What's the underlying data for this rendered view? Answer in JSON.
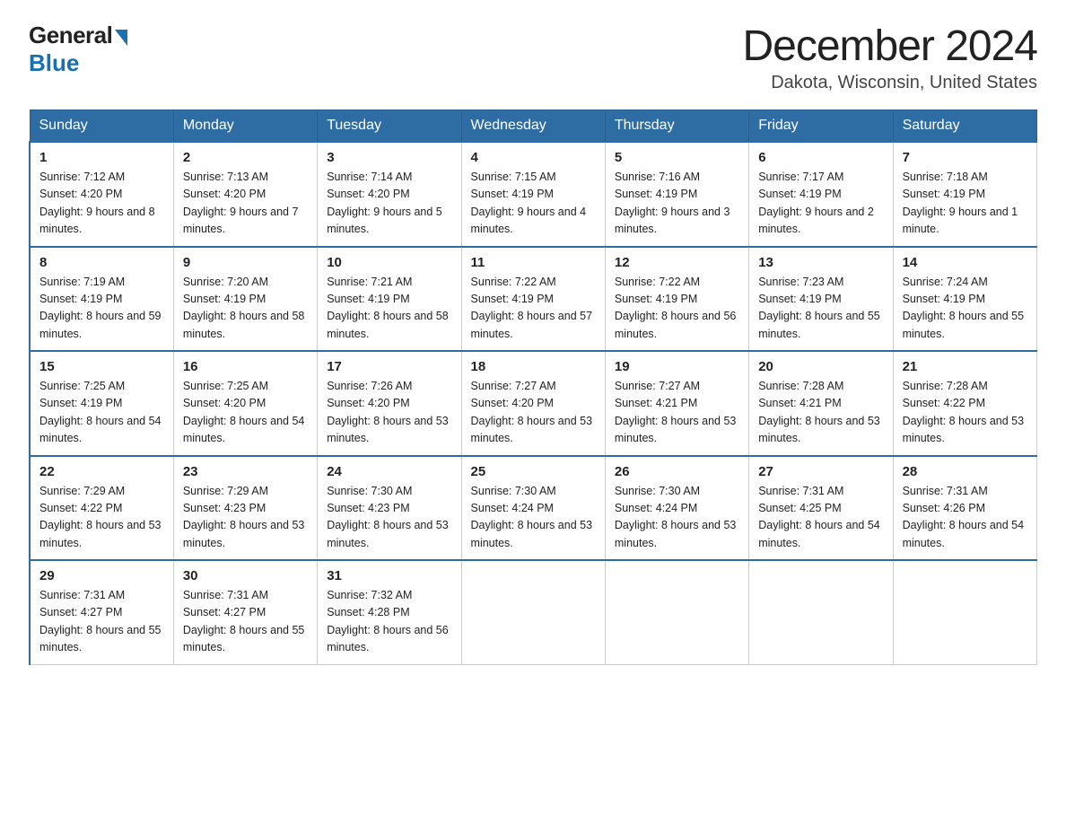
{
  "logo": {
    "general": "General",
    "blue": "Blue"
  },
  "title": {
    "month_year": "December 2024",
    "location": "Dakota, Wisconsin, United States"
  },
  "days_header": [
    "Sunday",
    "Monday",
    "Tuesday",
    "Wednesday",
    "Thursday",
    "Friday",
    "Saturday"
  ],
  "weeks": [
    [
      {
        "day": "1",
        "sunrise": "7:12 AM",
        "sunset": "4:20 PM",
        "daylight": "9 hours and 8 minutes."
      },
      {
        "day": "2",
        "sunrise": "7:13 AM",
        "sunset": "4:20 PM",
        "daylight": "9 hours and 7 minutes."
      },
      {
        "day": "3",
        "sunrise": "7:14 AM",
        "sunset": "4:20 PM",
        "daylight": "9 hours and 5 minutes."
      },
      {
        "day": "4",
        "sunrise": "7:15 AM",
        "sunset": "4:19 PM",
        "daylight": "9 hours and 4 minutes."
      },
      {
        "day": "5",
        "sunrise": "7:16 AM",
        "sunset": "4:19 PM",
        "daylight": "9 hours and 3 minutes."
      },
      {
        "day": "6",
        "sunrise": "7:17 AM",
        "sunset": "4:19 PM",
        "daylight": "9 hours and 2 minutes."
      },
      {
        "day": "7",
        "sunrise": "7:18 AM",
        "sunset": "4:19 PM",
        "daylight": "9 hours and 1 minute."
      }
    ],
    [
      {
        "day": "8",
        "sunrise": "7:19 AM",
        "sunset": "4:19 PM",
        "daylight": "8 hours and 59 minutes."
      },
      {
        "day": "9",
        "sunrise": "7:20 AM",
        "sunset": "4:19 PM",
        "daylight": "8 hours and 58 minutes."
      },
      {
        "day": "10",
        "sunrise": "7:21 AM",
        "sunset": "4:19 PM",
        "daylight": "8 hours and 58 minutes."
      },
      {
        "day": "11",
        "sunrise": "7:22 AM",
        "sunset": "4:19 PM",
        "daylight": "8 hours and 57 minutes."
      },
      {
        "day": "12",
        "sunrise": "7:22 AM",
        "sunset": "4:19 PM",
        "daylight": "8 hours and 56 minutes."
      },
      {
        "day": "13",
        "sunrise": "7:23 AM",
        "sunset": "4:19 PM",
        "daylight": "8 hours and 55 minutes."
      },
      {
        "day": "14",
        "sunrise": "7:24 AM",
        "sunset": "4:19 PM",
        "daylight": "8 hours and 55 minutes."
      }
    ],
    [
      {
        "day": "15",
        "sunrise": "7:25 AM",
        "sunset": "4:19 PM",
        "daylight": "8 hours and 54 minutes."
      },
      {
        "day": "16",
        "sunrise": "7:25 AM",
        "sunset": "4:20 PM",
        "daylight": "8 hours and 54 minutes."
      },
      {
        "day": "17",
        "sunrise": "7:26 AM",
        "sunset": "4:20 PM",
        "daylight": "8 hours and 53 minutes."
      },
      {
        "day": "18",
        "sunrise": "7:27 AM",
        "sunset": "4:20 PM",
        "daylight": "8 hours and 53 minutes."
      },
      {
        "day": "19",
        "sunrise": "7:27 AM",
        "sunset": "4:21 PM",
        "daylight": "8 hours and 53 minutes."
      },
      {
        "day": "20",
        "sunrise": "7:28 AM",
        "sunset": "4:21 PM",
        "daylight": "8 hours and 53 minutes."
      },
      {
        "day": "21",
        "sunrise": "7:28 AM",
        "sunset": "4:22 PM",
        "daylight": "8 hours and 53 minutes."
      }
    ],
    [
      {
        "day": "22",
        "sunrise": "7:29 AM",
        "sunset": "4:22 PM",
        "daylight": "8 hours and 53 minutes."
      },
      {
        "day": "23",
        "sunrise": "7:29 AM",
        "sunset": "4:23 PM",
        "daylight": "8 hours and 53 minutes."
      },
      {
        "day": "24",
        "sunrise": "7:30 AM",
        "sunset": "4:23 PM",
        "daylight": "8 hours and 53 minutes."
      },
      {
        "day": "25",
        "sunrise": "7:30 AM",
        "sunset": "4:24 PM",
        "daylight": "8 hours and 53 minutes."
      },
      {
        "day": "26",
        "sunrise": "7:30 AM",
        "sunset": "4:24 PM",
        "daylight": "8 hours and 53 minutes."
      },
      {
        "day": "27",
        "sunrise": "7:31 AM",
        "sunset": "4:25 PM",
        "daylight": "8 hours and 54 minutes."
      },
      {
        "day": "28",
        "sunrise": "7:31 AM",
        "sunset": "4:26 PM",
        "daylight": "8 hours and 54 minutes."
      }
    ],
    [
      {
        "day": "29",
        "sunrise": "7:31 AM",
        "sunset": "4:27 PM",
        "daylight": "8 hours and 55 minutes."
      },
      {
        "day": "30",
        "sunrise": "7:31 AM",
        "sunset": "4:27 PM",
        "daylight": "8 hours and 55 minutes."
      },
      {
        "day": "31",
        "sunrise": "7:32 AM",
        "sunset": "4:28 PM",
        "daylight": "8 hours and 56 minutes."
      },
      null,
      null,
      null,
      null
    ]
  ],
  "labels": {
    "sunrise": "Sunrise:",
    "sunset": "Sunset:",
    "daylight": "Daylight:"
  }
}
